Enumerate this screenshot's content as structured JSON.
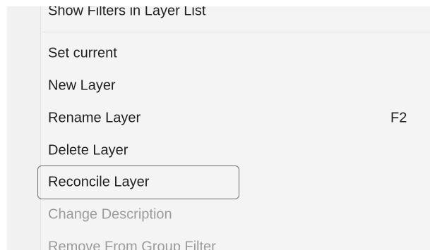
{
  "context_menu": {
    "items": [
      {
        "label": "Show Filters in Layer List",
        "shortcut": "",
        "enabled": true
      },
      {
        "label": "Set current",
        "shortcut": "",
        "enabled": true
      },
      {
        "label": "New Layer",
        "shortcut": "",
        "enabled": true
      },
      {
        "label": "Rename Layer",
        "shortcut": "F2",
        "enabled": true
      },
      {
        "label": "Delete Layer",
        "shortcut": "",
        "enabled": true
      },
      {
        "label": "Reconcile Layer",
        "shortcut": "",
        "enabled": true,
        "focused": true
      },
      {
        "label": "Change Description",
        "shortcut": "",
        "enabled": false
      },
      {
        "label": "Remove From Group Filter",
        "shortcut": "",
        "enabled": false
      }
    ]
  }
}
